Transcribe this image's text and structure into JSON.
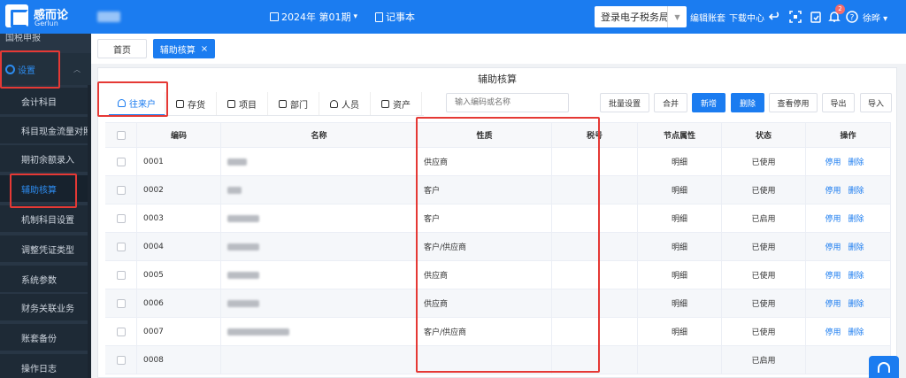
{
  "brand": {
    "name": "感而论",
    "sub": "Gerlun"
  },
  "header": {
    "period": "2024年 第01期",
    "notebook": "记事本",
    "tax_bureau": "登录电子税务局",
    "edit_ledger": "编辑账套",
    "download_center": "下载中心",
    "notifications": "2",
    "user": "徐晔"
  },
  "sidebar": {
    "top_item": "国税申报",
    "group": "设置",
    "items": [
      "会计科目",
      "科目现金流量对照",
      "期初余额录入",
      "辅助核算",
      "机制科目设置",
      "调整凭证类型",
      "系统参数",
      "财务关联业务",
      "账套备份",
      "操作日志"
    ],
    "active_index": 3
  },
  "page_tabs": [
    {
      "label": "首页",
      "active": false
    },
    {
      "label": "辅助核算",
      "active": true,
      "close": "×"
    }
  ],
  "panel": {
    "title": "辅助核算",
    "category_tabs": [
      "往来户",
      "存货",
      "项目",
      "部门",
      "人员",
      "资产"
    ],
    "active_category": 0,
    "search_placeholder": "输入编码或名称",
    "actions": [
      "批量设置",
      "合并",
      "新增",
      "删除",
      "查看停用",
      "导出",
      "导入"
    ],
    "columns": [
      "编码",
      "名称",
      "性质",
      "税号",
      "节点属性",
      "状态",
      "操作"
    ],
    "rows": [
      {
        "code": "0001",
        "type": "供应商",
        "tax": "",
        "node": "明细",
        "status": "已使用",
        "ops": [
          "停用",
          "删除"
        ]
      },
      {
        "code": "0002",
        "type": "客户",
        "tax": "",
        "node": "明细",
        "status": "已使用",
        "ops": [
          "停用",
          "删除"
        ]
      },
      {
        "code": "0003",
        "type": "客户",
        "tax": "",
        "node": "明细",
        "status": "已启用",
        "ops": [
          "停用",
          "删除"
        ]
      },
      {
        "code": "0004",
        "type": "客户/供应商",
        "tax": "",
        "node": "明细",
        "status": "已使用",
        "ops": [
          "停用",
          "删除"
        ]
      },
      {
        "code": "0005",
        "type": "供应商",
        "tax": "",
        "node": "明细",
        "status": "已使用",
        "ops": [
          "停用",
          "删除"
        ]
      },
      {
        "code": "0006",
        "type": "供应商",
        "tax": "",
        "node": "明细",
        "status": "已使用",
        "ops": [
          "停用",
          "删除"
        ]
      },
      {
        "code": "0007",
        "type": "客户/供应商",
        "tax": "",
        "node": "明细",
        "status": "已使用",
        "ops": [
          "停用",
          "删除"
        ]
      },
      {
        "code": "0008",
        "type": "",
        "tax": "",
        "node": "",
        "status": "已启用",
        "ops": []
      }
    ]
  },
  "colors": {
    "primary": "#1b7cf0",
    "sidebar": "#283645",
    "highlight": "#e53935"
  }
}
